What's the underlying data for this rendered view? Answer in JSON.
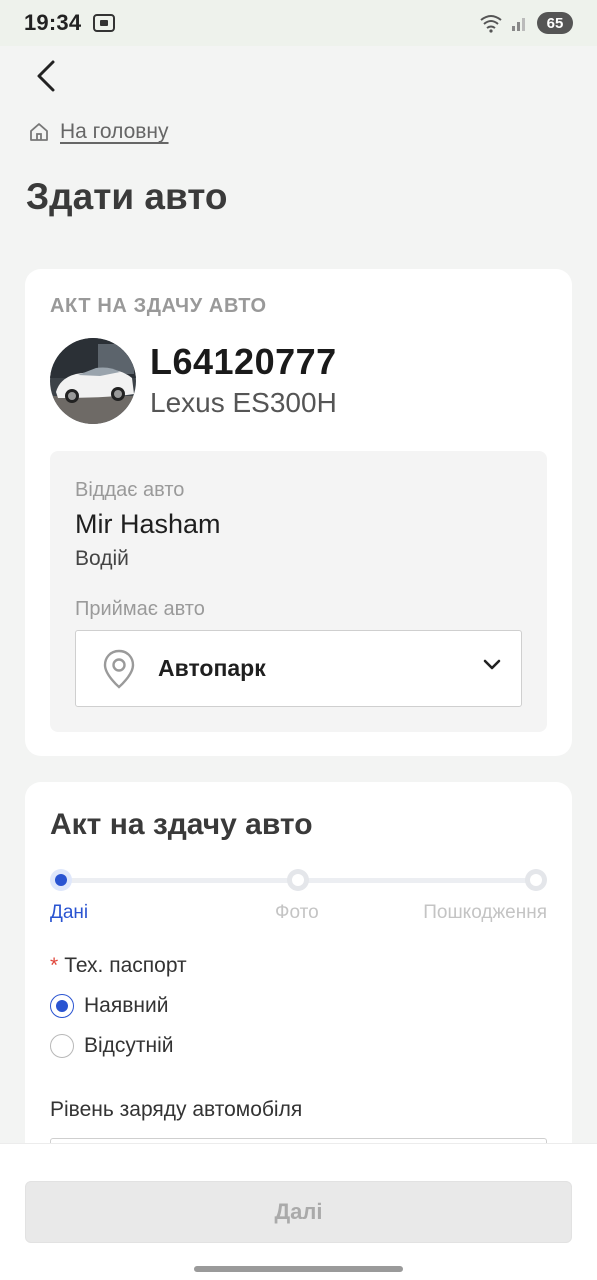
{
  "status_bar": {
    "time": "19:34",
    "battery": "65",
    "icons": [
      "screen-record-icon",
      "wifi-icon",
      "signal-icon",
      "battery-icon"
    ]
  },
  "nav": {
    "back_icon": "chevron-left-icon",
    "breadcrumb_icon": "home-icon",
    "breadcrumb_label": "На головну"
  },
  "page": {
    "title": "Здати авто"
  },
  "vehicle_card": {
    "section_label": "АКТ НА ЗДАЧУ АВТО",
    "plate": "L64120777",
    "model": "Lexus ES300H",
    "giver_label": "Віддає авто",
    "giver_name": "Mir Hasham",
    "giver_role": "Водій",
    "receiver_label": "Приймає авто",
    "receiver_value": "Автопарк",
    "receiver_icon": "location-pin-icon"
  },
  "act_card": {
    "title": "Акт на здачу авто",
    "steps": [
      {
        "label": "Дані",
        "active": true
      },
      {
        "label": "Фото",
        "active": false
      },
      {
        "label": "Пошкодження",
        "active": false
      }
    ],
    "tech_passport_label": "Тех. паспорт",
    "required_mark": "*",
    "options": [
      {
        "label": "Наявний",
        "checked": true
      },
      {
        "label": "Відсутній",
        "checked": false
      }
    ],
    "charge_label": "Рівень заряду автомобіля"
  },
  "footer": {
    "next_label": "Далі"
  },
  "colors": {
    "accent": "#2a54d1",
    "background": "#f3f4f3",
    "required": "#e0463b"
  }
}
